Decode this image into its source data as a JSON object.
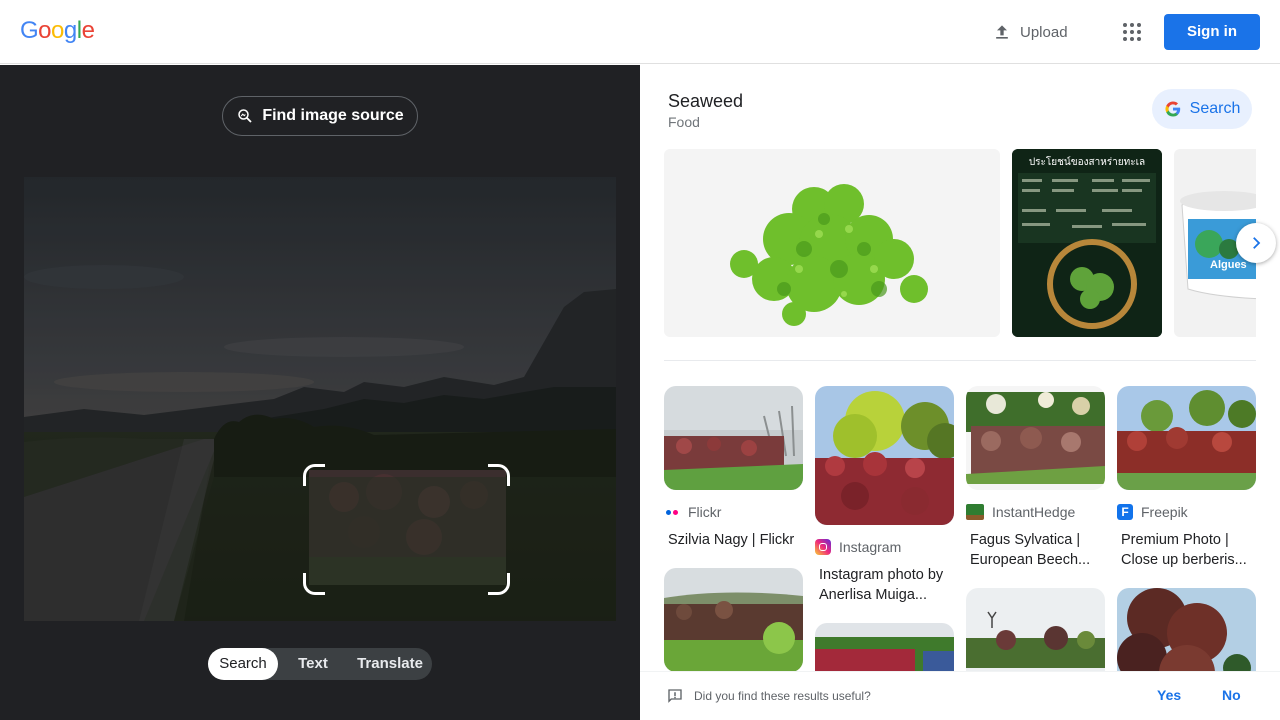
{
  "header": {
    "logo": {
      "letters": [
        "G",
        "o",
        "o",
        "g",
        "l",
        "e"
      ],
      "colors": [
        "#4285F4",
        "#EA4335",
        "#FBBC05",
        "#4285F4",
        "#34A853",
        "#EA4335"
      ]
    },
    "upload_label": "Upload",
    "signin_label": "Sign in",
    "apps_icon": "apps-grid-icon",
    "accent": "#1a73e8"
  },
  "lens": {
    "find_source_label": "Find image source",
    "modes": [
      {
        "label": "Search",
        "active": true
      },
      {
        "label": "Text",
        "active": false
      },
      {
        "label": "Translate",
        "active": false
      }
    ]
  },
  "knowledge_panel": {
    "title": "Seaweed",
    "subtitle": "Food",
    "search_label": "Search",
    "image_text": "ประโยชน์ของสาหร่ายทะเล",
    "product_text": "Algues"
  },
  "results": [
    {
      "source": "Flickr",
      "title": "Szilvia Nagy | Flickr",
      "icon": "flickr-icon"
    },
    {
      "source": "Instagram",
      "title": "Instagram photo by Anerlisa Muiga...",
      "icon": "instagram-icon"
    },
    {
      "source": "InstantHedge",
      "title": "Fagus Sylvatica | European Beech...",
      "icon": "instanthedge-icon"
    },
    {
      "source": "Freepik",
      "title": "Premium Photo | Close up berberis...",
      "icon": "freepik-icon"
    }
  ],
  "feedback": {
    "question": "Did you find these results useful?",
    "yes": "Yes",
    "no": "No"
  }
}
